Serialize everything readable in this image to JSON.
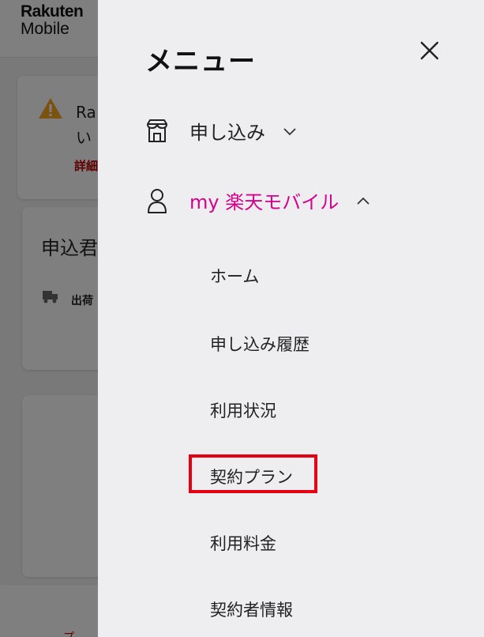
{
  "background": {
    "logo": {
      "line1": "Rakuten",
      "line2": "Mobile"
    },
    "alert": {
      "text": "Ra い",
      "link": "詳細"
    },
    "card2": {
      "title": "申込君",
      "sub": "出荷"
    },
    "bottom_link": "プ"
  },
  "drawer": {
    "title": "メニュー",
    "close_label": "×",
    "sections": [
      {
        "label": "申し込み",
        "icon": "store-icon",
        "expanded": false
      },
      {
        "label": "my 楽天モバイル",
        "icon": "person-icon",
        "expanded": true
      }
    ],
    "my_items": [
      {
        "label": "ホーム"
      },
      {
        "label": "申し込み履歴"
      },
      {
        "label": "利用状況"
      },
      {
        "label": "契約プラン",
        "highlighted": true
      },
      {
        "label": "利用料金"
      },
      {
        "label": "契約者情報"
      }
    ]
  },
  "colors": {
    "accent": "#d6008c",
    "highlight": "#e60012",
    "brand_red": "#bf0000",
    "drawer_bg": "#eeeef0",
    "warning": "#f5a623"
  }
}
